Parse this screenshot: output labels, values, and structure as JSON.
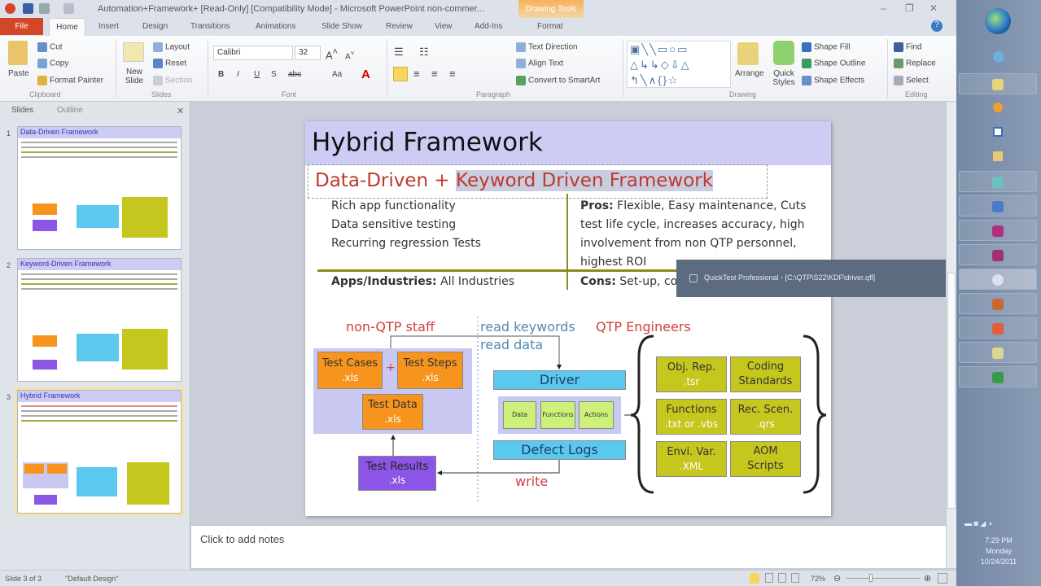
{
  "window": {
    "title": "Automation+Framework+ [Read-Only] [Compatibility Mode] - Microsoft PowerPoint non-commer...",
    "contextual_tab": "Drawing Tools"
  },
  "tabs": [
    "File",
    "Home",
    "Insert",
    "Design",
    "Transitions",
    "Animations",
    "Slide Show",
    "Review",
    "View",
    "Add-Ins",
    "Format"
  ],
  "ribbon": {
    "clipboard": {
      "label": "Clipboard",
      "paste": "Paste",
      "cut": "Cut",
      "copy": "Copy",
      "format_painter": "Format Painter"
    },
    "slides": {
      "label": "Slides",
      "new_slide": "New Slide",
      "layout": "Layout",
      "reset": "Reset",
      "section": "Section"
    },
    "font": {
      "label": "Font",
      "family": "Calibri",
      "size": "32"
    },
    "paragraph": {
      "label": "Paragraph",
      "text_direction": "Text Direction",
      "align_text": "Align Text",
      "convert_smartart": "Convert to SmartArt"
    },
    "drawing": {
      "label": "Drawing",
      "arrange": "Arrange",
      "quick_styles": "Quick Styles",
      "shape_fill": "Shape Fill",
      "shape_outline": "Shape Outline",
      "shape_effects": "Shape Effects"
    },
    "editing": {
      "label": "Editing",
      "find": "Find",
      "replace": "Replace",
      "select": "Select"
    }
  },
  "pane": {
    "tabs": [
      "Slides",
      "Outline"
    ],
    "thumbs": [
      {
        "num": "1",
        "title": "Data-Driven Framework"
      },
      {
        "num": "2",
        "title": "Keyword-Driven Framework"
      },
      {
        "num": "3",
        "title": "Hybrid Framework"
      }
    ]
  },
  "slide": {
    "title": "Hybrid Framework",
    "subtitle_a": "Data-Driven + ",
    "subtitle_b": "Keyword Driven Framework",
    "bullets": [
      "Rich app functionality",
      "Data sensitive testing",
      "Recurring regression Tests"
    ],
    "pros_label": "Pros:",
    "pros": [
      "Flexible, Easy maintenance, Cuts",
      "test life cycle, increases accuracy, high",
      "involvement from non QTP personnel,",
      "highest ROI"
    ],
    "apps_label": "Apps/Industries:",
    "apps": "All Industries",
    "cons_label": "Cons:",
    "cons": "Set-up, co",
    "diagram": {
      "non_qtp": "non-QTP staff",
      "read_keywords": "read keywords",
      "read_data": "read data",
      "qtp_eng": "QTP Engineers",
      "plus": "+",
      "write": "write",
      "test_cases": "Test Cases",
      "test_steps": "Test Steps",
      "test_data": "Test Data",
      "test_results": "Test Results",
      "xls": ".xls",
      "driver": "Driver",
      "defect_logs": "Defect Logs",
      "data": "Data",
      "functions": "Functions",
      "actions": "Actions",
      "grid": [
        [
          "Obj. Rep.",
          ".tsr"
        ],
        [
          "Coding",
          "Standards"
        ],
        [
          "Functions",
          ".txt or .vbs"
        ],
        [
          "Rec. Scen.",
          ".qrs"
        ],
        [
          "Envi. Var.",
          ".XML"
        ],
        [
          "AOM",
          "Scripts"
        ]
      ]
    }
  },
  "tooltip": "QuickTest Professional - [C:\\QTP\\S22\\KDF\\driver.qfl]",
  "notes_placeholder": "Click to add notes",
  "status": {
    "slide": "Slide 3 of 3",
    "theme": "\"Default Design\"",
    "zoom": "72%"
  },
  "clock": {
    "time": "7:29 PM",
    "day": "Monday",
    "date": "10/24/2011"
  },
  "colors": {
    "file_tab": "#d24726",
    "orange": "#f7941d",
    "cyan": "#5bc8ee",
    "olive": "#c5c71e",
    "purple": "#8b55e6",
    "red_text": "#c0392b"
  }
}
